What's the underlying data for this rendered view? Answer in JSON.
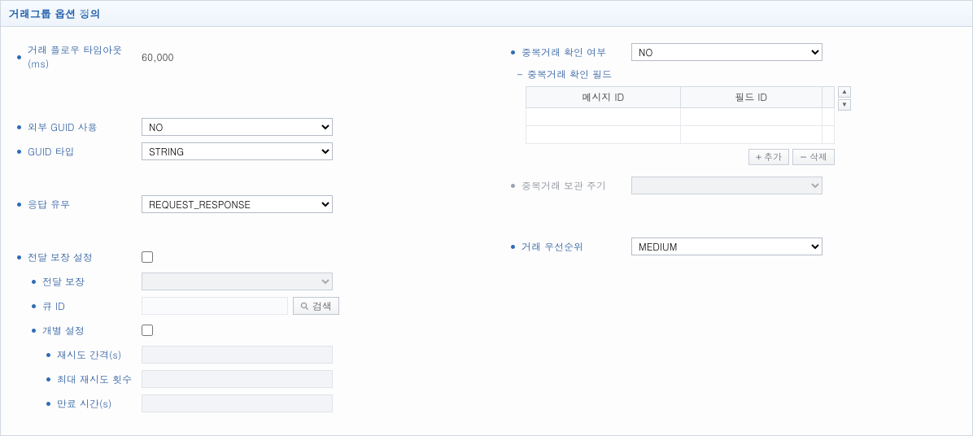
{
  "header": {
    "title": "거래그룹 옵션 정의"
  },
  "left": {
    "flow_timeout_label": "거래 플로우 타임아웃(ms)",
    "flow_timeout_value": "60,000",
    "ext_guid_label": "외부 GUID 사용",
    "ext_guid_value": "NO",
    "guid_type_label": "GUID 타입",
    "guid_type_value": "STRING",
    "response_label": "응답 유무",
    "response_value": "REQUEST_RESPONSE",
    "delivery_header": "전달 보장 설정",
    "delivery_label": "전달 보장",
    "queue_id_label": "큐 ID",
    "queue_search_label": "검색",
    "individual_header": "개별 설정",
    "retry_interval_label": "재시도 간격(s)",
    "max_retry_label": "최대 재시도 횟수",
    "expire_label": "만료 시간(s)"
  },
  "right": {
    "dup_check_label": "중복거래 확인 여부",
    "dup_check_value": "NO",
    "dup_fields_label": "중복거래 확인 필드",
    "table": {
      "col1": "메시지 ID",
      "col2": "필드 ID"
    },
    "add_label": "추가",
    "del_label": "삭제",
    "dup_keep_label": "중복거래 보관 주기",
    "priority_label": "거래 우선순위",
    "priority_value": "MEDIUM"
  }
}
